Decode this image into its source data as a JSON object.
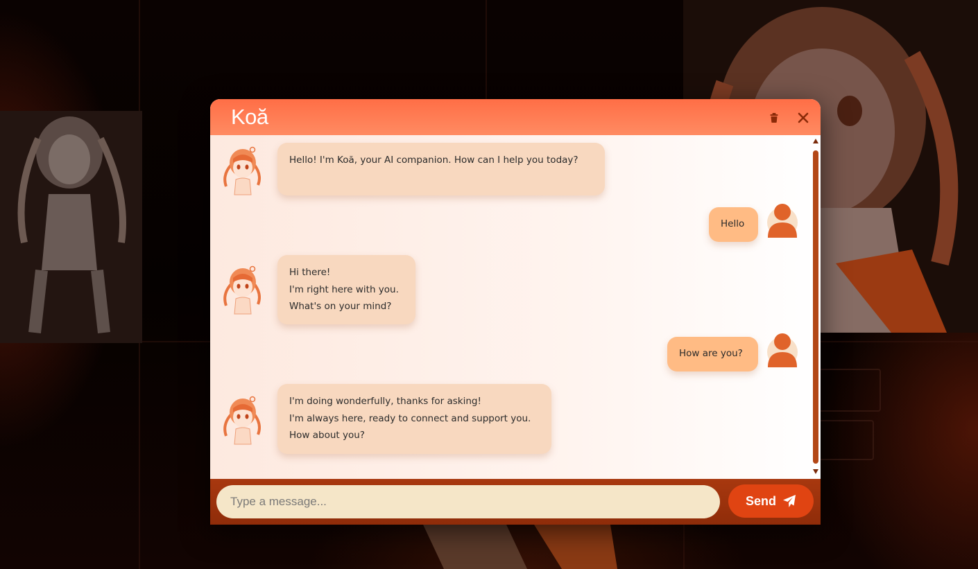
{
  "app": {
    "brand": "Koă"
  },
  "header": {
    "trash_icon": "trash-icon",
    "close_icon": "close-icon"
  },
  "messages": [
    {
      "sender": "bot",
      "lines": [
        "Hello! I'm Koă, your AI companion. How can I help you today?"
      ]
    },
    {
      "sender": "user",
      "text": "Hello"
    },
    {
      "sender": "bot",
      "lines": [
        "Hi there!",
        "I'm right here with you.",
        "What's on your mind?"
      ]
    },
    {
      "sender": "user",
      "text": "How are you?"
    },
    {
      "sender": "bot",
      "lines": [
        "I'm doing wonderfully, thanks for asking!",
        "I'm always here, ready to connect and support you.",
        "How about you?"
      ]
    }
  ],
  "input": {
    "placeholder": "Type a message...",
    "value": ""
  },
  "send": {
    "label": "Send",
    "icon": "paper-plane-icon"
  },
  "colors": {
    "header": "#ff7a50",
    "bot_bubble": "#f8d8bf",
    "user_bubble": "#ffbb84",
    "input_bar": "#9c330c",
    "input_field": "#f5e6c8",
    "send_button": "#e04412",
    "accent_dark": "#b34716"
  }
}
